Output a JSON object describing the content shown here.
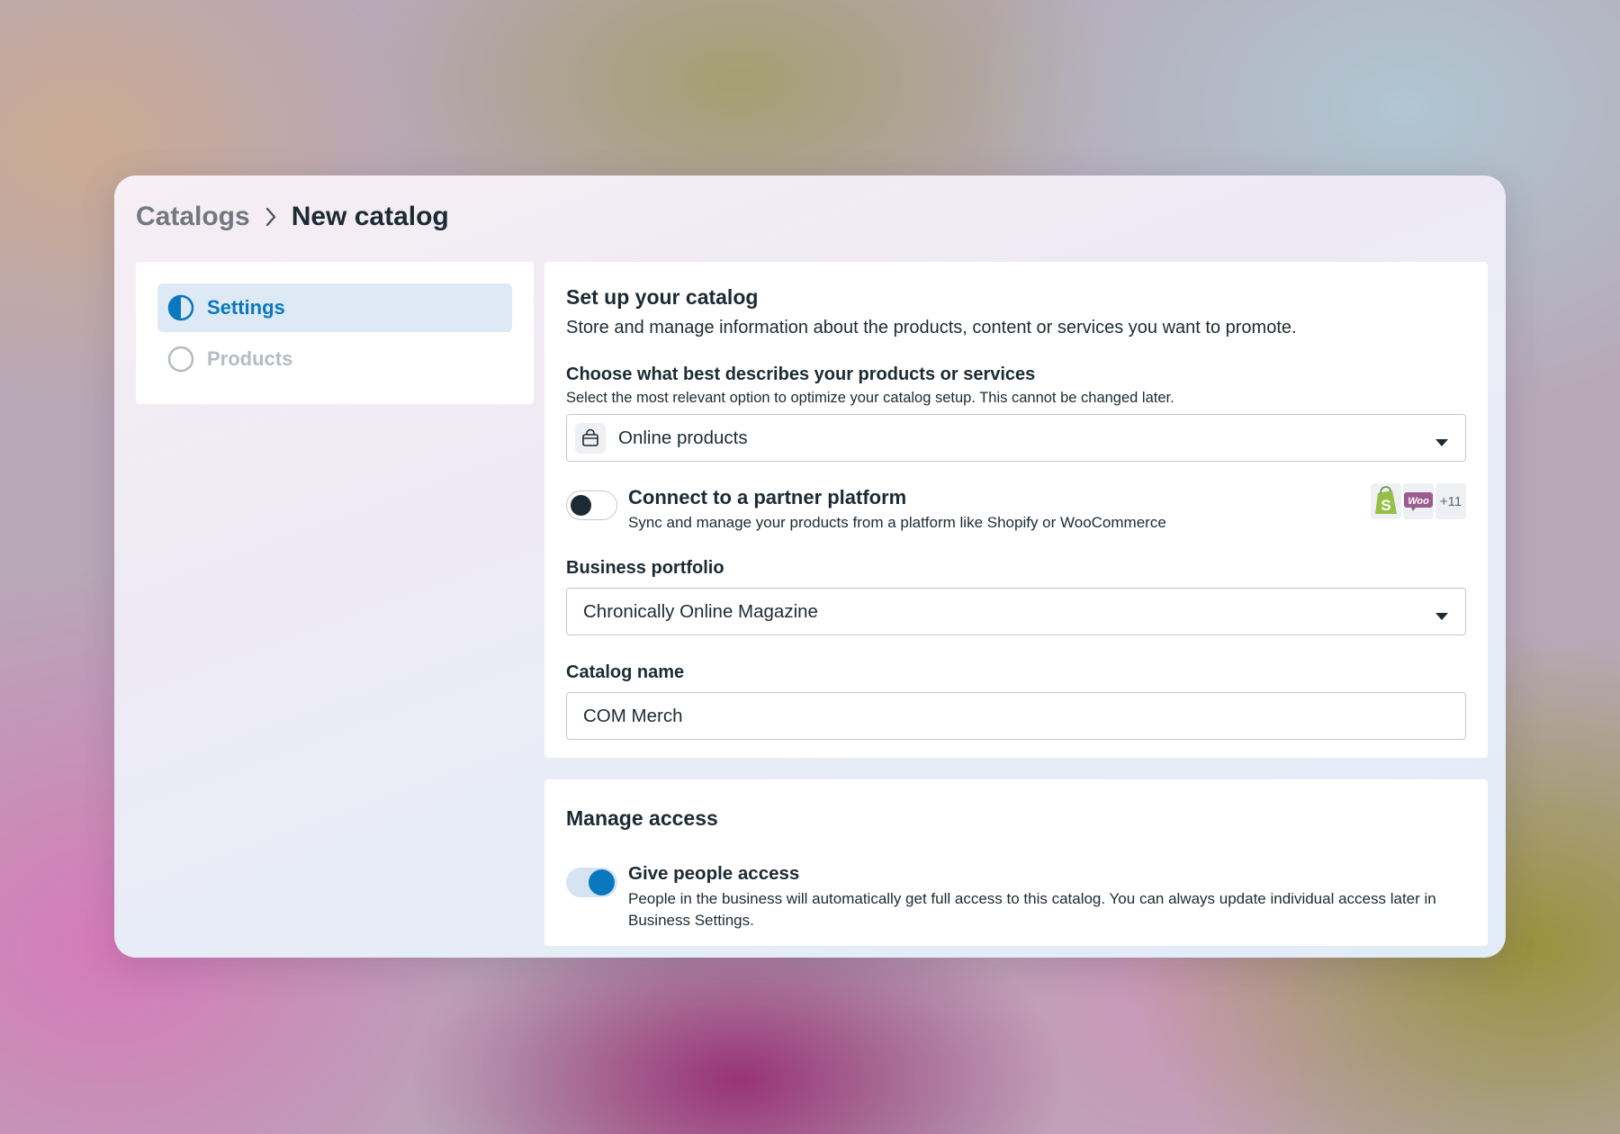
{
  "breadcrumb": {
    "parent": "Catalogs",
    "current": "New catalog"
  },
  "steps": [
    {
      "label": "Settings",
      "state": "in-progress"
    },
    {
      "label": "Products",
      "state": "not-started"
    }
  ],
  "setup": {
    "title": "Set up your catalog",
    "description": "Store and manage information about the products, content or services you want to promote.",
    "product_type": {
      "label": "Choose what best describes your products or services",
      "help": "Select the most relevant option to optimize your catalog setup. This cannot be changed later.",
      "value": "Online products",
      "icon": "shopping-bag-icon"
    },
    "partner": {
      "title": "Connect to a partner platform",
      "description": "Sync and manage your products from a platform like Shopify or WooCommerce",
      "enabled": false,
      "logos": [
        "shopify-logo",
        "woocommerce-logo"
      ],
      "woo_text": "Woo",
      "more_count": "+11"
    },
    "business_portfolio": {
      "label": "Business portfolio",
      "value": "Chronically Online Magazine"
    },
    "catalog_name": {
      "label": "Catalog name",
      "value": "COM Merch"
    }
  },
  "access": {
    "title": "Manage access",
    "toggle_title": "Give people access",
    "toggle_description": "People in the business will automatically get full access to this catalog. You can always update individual access later in Business Settings.",
    "enabled": true
  },
  "colors": {
    "accent": "#0a78be",
    "text": "#1c2b33",
    "shopify_green": "#95bf47",
    "woo_purple": "#9b5c8f"
  }
}
